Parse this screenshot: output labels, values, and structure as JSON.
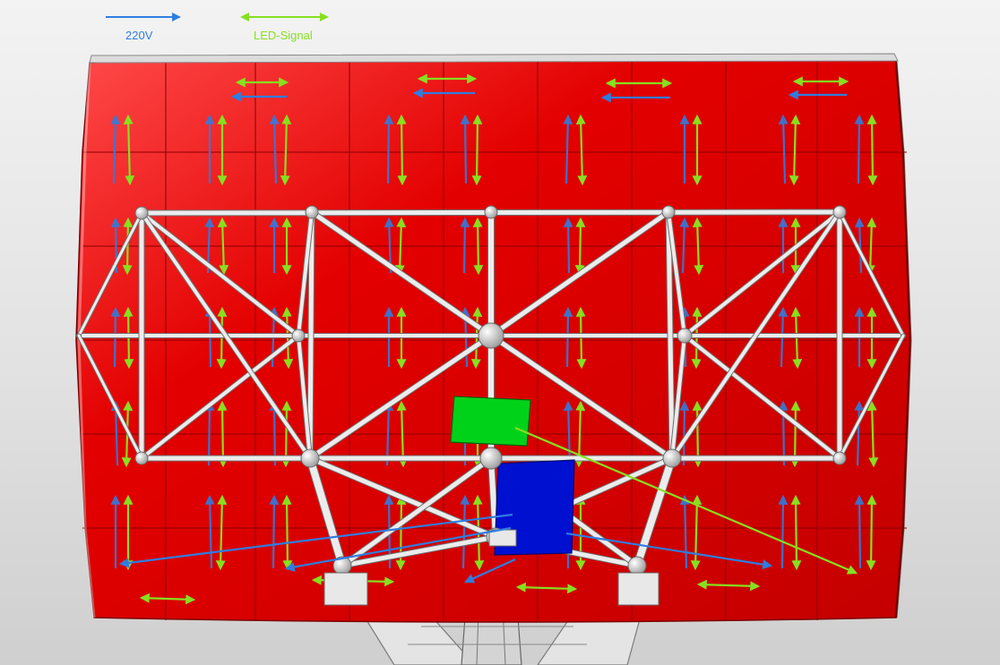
{
  "legend": {
    "power": {
      "label": "220V",
      "color": "#2f7de0"
    },
    "signal": {
      "label": "LED-Signal",
      "color": "#86e020"
    }
  },
  "colors": {
    "panel": "#e10000",
    "panel_dark": "#b80000",
    "frame": "#e6e6e6",
    "frame_edge": "#8a8a8a",
    "controller_green": "#00d21a",
    "controller_blue": "#0010d0"
  },
  "components": [
    {
      "name": "led-screen-panel-grid"
    },
    {
      "name": "support-truss-frame"
    },
    {
      "name": "signal-controller-box"
    },
    {
      "name": "power-distribution-box"
    },
    {
      "name": "mounting-pole"
    }
  ]
}
